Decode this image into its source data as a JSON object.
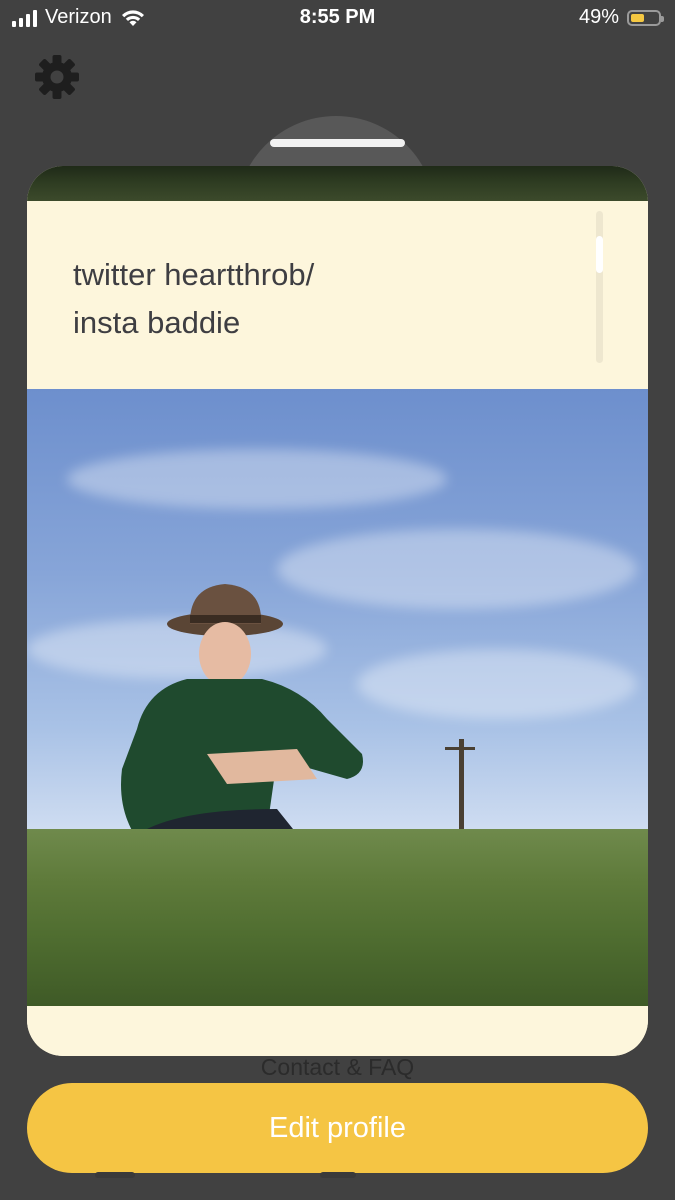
{
  "status_bar": {
    "carrier": "Verizon",
    "time": "8:55 PM",
    "battery_percent": "49%",
    "battery_level": 0.49,
    "icons": [
      "signal-icon",
      "wifi-icon",
      "battery-icon"
    ]
  },
  "header": {
    "settings_icon": "gear-icon"
  },
  "profile_card": {
    "bio_text": "twitter heartthrob/\ninsta baddie",
    "photo_description_icon": "profile-photo"
  },
  "footer": {
    "contact_link": "Contact & FAQ",
    "edit_button": "Edit profile"
  },
  "colors": {
    "accent": "#f5c544",
    "card_background": "#fdf6dc",
    "page_background": "#414141"
  }
}
